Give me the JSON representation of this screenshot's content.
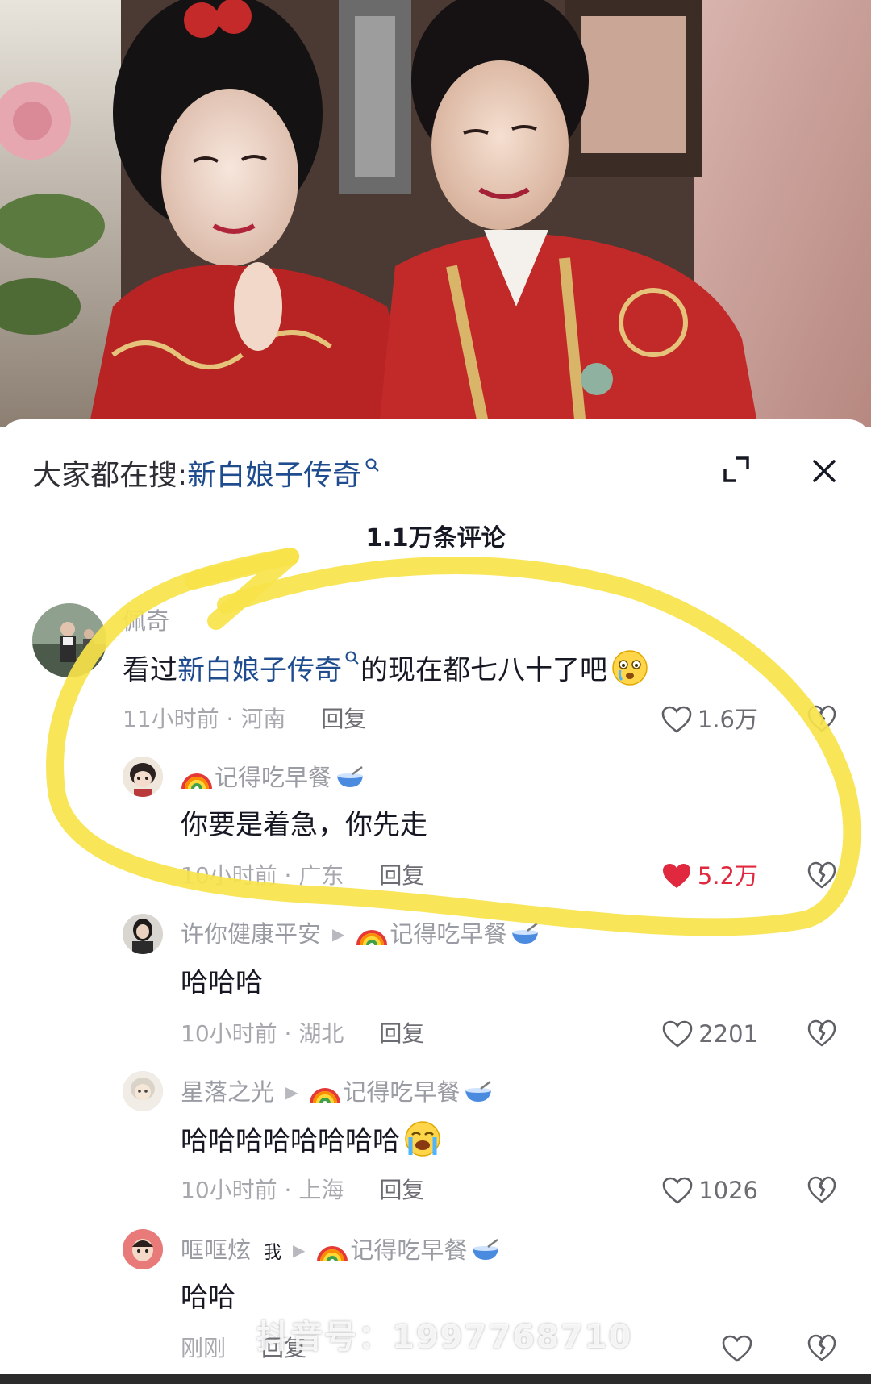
{
  "header": {
    "search_prefix": "大家都在搜:",
    "search_keyword": "新白娘子传奇"
  },
  "comment_count": "1.1万条评论",
  "comments": [
    {
      "username": "佩奇",
      "text_prefix": "看过",
      "text_keyword": "新白娘子传奇",
      "text_suffix": "的现在都七八十了吧",
      "time_location": "11小时前 · 河南",
      "reply_label": "回复",
      "likes": "1.6万",
      "liked": false,
      "emoji": "crying-face-emoji"
    },
    {
      "username": "记得吃早餐",
      "text": "你要是着急，你先走",
      "time_location": "10小时前 · 广东",
      "reply_label": "回复",
      "likes": "5.2万",
      "liked": true
    },
    {
      "username": "许你健康平安",
      "reply_to": "记得吃早餐",
      "text": "哈哈哈",
      "time_location": "10小时前 · 湖北",
      "reply_label": "回复",
      "likes": "2201",
      "liked": false
    },
    {
      "username": "星落之光",
      "reply_to": "记得吃早餐",
      "text": "哈哈哈哈哈哈哈哈",
      "time_location": "10小时前 · 上海",
      "reply_label": "回复",
      "likes": "1026",
      "liked": false,
      "emoji": "loudly-crying-emoji"
    },
    {
      "username": "哐哐炫",
      "author_badge": "我",
      "reply_to": "记得吃早餐",
      "text": "哈哈",
      "time_location": "刚刚",
      "reply_label": "回复",
      "likes": "",
      "liked": false
    }
  ],
  "watermark": "抖音号：1997768710",
  "colors": {
    "keyword_blue": "#1f4c8f",
    "like_red": "#e0293e",
    "highlight_yellow": "#f7e34a"
  }
}
